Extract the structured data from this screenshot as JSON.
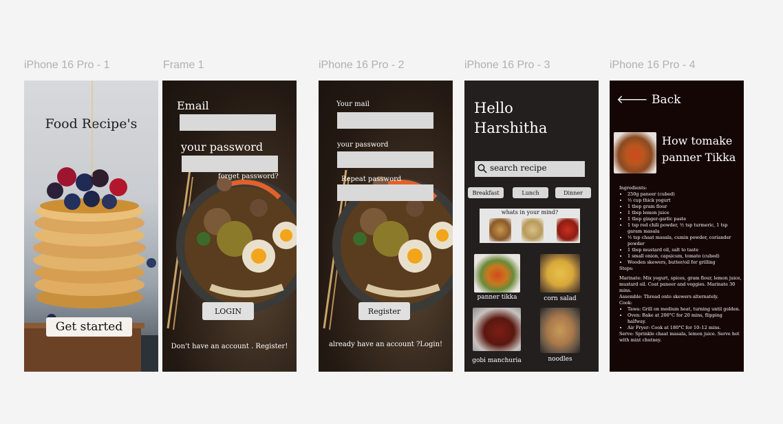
{
  "frame_labels": [
    "iPhone 16 Pro - 1",
    "Frame 1",
    "iPhone 16 Pro - 2",
    "iPhone 16 Pro - 3",
    "iPhone 16 Pro - 4"
  ],
  "welcome": {
    "title": "Food Recipe's",
    "button": "Get started"
  },
  "login": {
    "email_label": "Email",
    "password_label": "your password",
    "forgot": "forget password?",
    "button": "LOGIN",
    "footer": "Don't have an account . Register!"
  },
  "register": {
    "mail_label": "Your mail",
    "password_label": "your password",
    "repeat_label": "Repeat password",
    "button": "Register",
    "footer": "already have an account ?Login!"
  },
  "home": {
    "greeting_line1": "Hello",
    "greeting_line2": "Harshitha",
    "search_placeholder": "search recipe",
    "chips": [
      "Breakfast",
      "Lunch",
      "Dinner"
    ],
    "mind_title": "whats in your mind?",
    "cards": [
      "panner tikka",
      "corn salad",
      "gobi manchuria",
      "noodles"
    ]
  },
  "recipe": {
    "back": "Back",
    "title_line1": "How tomake",
    "title_line2": "panner Tikka",
    "ingredients_heading": "Ingredients:",
    "ingredients": [
      "250g paneer (cubed)",
      "½ cup thick yogurt",
      "1 tbsp gram flour",
      "1 tbsp lemon juice",
      "1 tbsp ginger-garlic paste",
      "1 tsp red chili powder, ½ tsp turmeric, 1 tsp garam masala",
      "½ tsp chaat masala, cumin powder, coriander powder",
      "1 tbsp mustard oil, salt to taste",
      "1 small onion, capsicum, tomato (cubed)",
      "Wooden skewers, butter/oil for grilling"
    ],
    "steps_heading": "Steps:",
    "step_marinate": "Marinate: Mix yogurt, spices, gram flour, lemon juice, mustard oil. Coat paneer and veggies. Marinate 30 mins.",
    "step_assemble": "Assemble: Thread onto skewers alternately.",
    "step_cook": "Cook:",
    "cook_methods": [
      "Tawa: Grill on medium heat, turning until golden.",
      "Oven: Bake at 200°C for 20 mins, flipping halfway.",
      "Air Fryer: Cook at 180°C for 10–12 mins."
    ],
    "step_serve": "Serve: Sprinkle chaat masala, lemon juice. Serve hot with mint chutney."
  },
  "colors": {
    "canvas": "#f4f4f4",
    "field": "#d9d9d9",
    "home_bg": "#231f1f",
    "recipe_bg": "#150606"
  }
}
